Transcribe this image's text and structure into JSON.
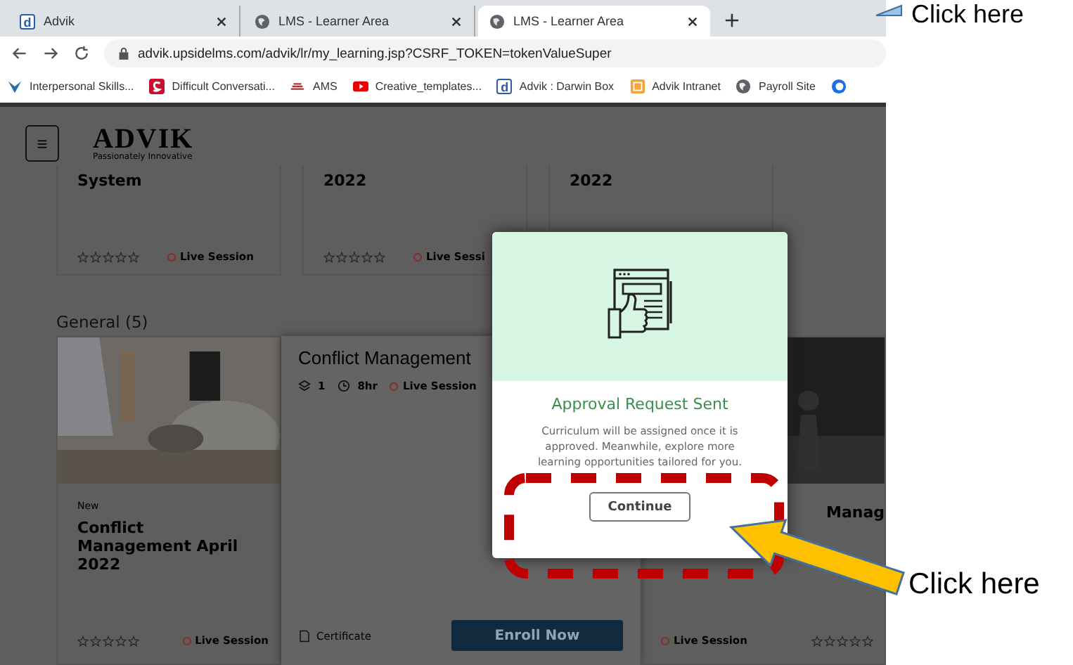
{
  "browser": {
    "tabs": [
      {
        "title": "Advik",
        "favicon_text": "d",
        "selected": false
      },
      {
        "title": "LMS - Learner Area",
        "selected": false
      },
      {
        "title": "LMS - Learner Area",
        "selected": true
      }
    ],
    "address": "advik.upsidelms.com/advik/lr/my_learning.jsp?CSRF_TOKEN=tokenValueSuper",
    "bookmarks": [
      {
        "label": "Interpersonal Skills..."
      },
      {
        "label": "Difficult Conversati..."
      },
      {
        "label": "AMS"
      },
      {
        "label": "Creative_templates..."
      },
      {
        "label": "Advik : Darwin Box",
        "icon_text": "d"
      },
      {
        "label": "Advik Intranet"
      },
      {
        "label": "Payroll Site"
      }
    ]
  },
  "page": {
    "logo": "ADVIK",
    "tagline": "Passionately Innovative",
    "top_cards": [
      {
        "title": "System",
        "stars": 0,
        "session": "Live Session"
      },
      {
        "title": "2022",
        "stars": 0,
        "session": "Live Sessi"
      },
      {
        "title": "2022"
      }
    ],
    "section": "General (5)",
    "cards": [
      {
        "kind": "tile",
        "tag": "New",
        "title": "Conflict Management April 2022",
        "stars": 0,
        "session": "Live Session"
      },
      {
        "kind": "detail",
        "title": "Conflict Management",
        "modules": "1",
        "duration": "8hr",
        "session": "Live Session",
        "certificate": "Certificate",
        "button": "Enroll Now"
      },
      {
        "kind": "tile",
        "title": "Manag",
        "session": "Live Session",
        "stars": 0
      }
    ]
  },
  "dialog": {
    "title": "Approval Request Sent",
    "message": "Curriculum will be assigned once it is approved. Meanwhile, explore more learning opportunities tailored for you.",
    "button": "Continue"
  },
  "top_callout": {
    "text": "Click here"
  },
  "arrow_callout": {
    "text": "Click here"
  }
}
